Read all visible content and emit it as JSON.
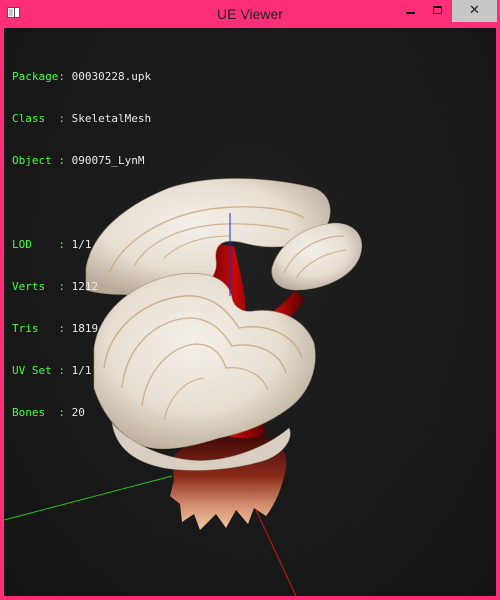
{
  "window": {
    "title": "UE Viewer",
    "close_glyph": "✕"
  },
  "info": {
    "package": {
      "label": "Package: ",
      "value": "00030228.upk"
    },
    "class": {
      "label": "Class  : ",
      "value": "SkeletalMesh"
    },
    "object": {
      "label": "Object : ",
      "value": "090075_LynM"
    },
    "lod": {
      "label": "LOD    : ",
      "value": "1/1"
    },
    "verts": {
      "label": "Verts  : ",
      "value": "1212"
    },
    "tris": {
      "label": "Tris   : ",
      "value": "1819"
    },
    "uvset": {
      "label": "UV Set : ",
      "value": "1/1"
    },
    "bones": {
      "label": "Bones  : ",
      "value": "20"
    }
  },
  "colors": {
    "window_frame": "#ff2e78",
    "label_text": "#3dff3d",
    "value_text": "#e8e8e8",
    "axis_x": "#d11414",
    "axis_y": "#1ec41e",
    "axis_z": "#2222dd"
  }
}
